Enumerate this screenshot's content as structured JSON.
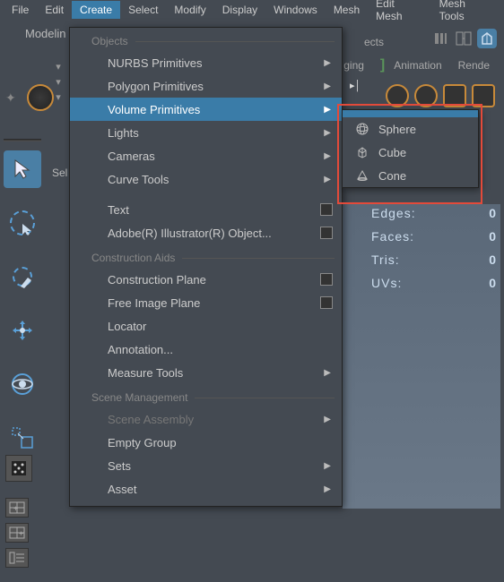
{
  "menubar": [
    "File",
    "Edit",
    "Create",
    "Select",
    "Modify",
    "Display",
    "Windows",
    "Mesh",
    "Edit Mesh",
    "Mesh Tools"
  ],
  "active_menu_index": 2,
  "mode_label": "Modelin",
  "ects_fragment": "ects",
  "shelf_tabs": {
    "ging": "ging",
    "animation": "Animation",
    "render": "Rende"
  },
  "sel_label": "Sel",
  "hud": [
    {
      "label": "Edges:",
      "value": "0"
    },
    {
      "label": "Faces:",
      "value": "0"
    },
    {
      "label": "Tris:",
      "value": "0"
    },
    {
      "label": "UVs:",
      "value": "0"
    }
  ],
  "dropdown": {
    "sections": {
      "objects": "Objects",
      "construction": "Construction Aids",
      "scene": "Scene Management"
    },
    "items": {
      "nurbs": "NURBS Primitives",
      "polygon": "Polygon Primitives",
      "volume": "Volume Primitives",
      "lights": "Lights",
      "cameras": "Cameras",
      "curve": "Curve Tools",
      "text": "Text",
      "illustrator": "Adobe(R) Illustrator(R) Object...",
      "cplane": "Construction Plane",
      "fip": "Free Image Plane",
      "locator": "Locator",
      "annotation": "Annotation...",
      "measure": "Measure Tools",
      "sceneasm": "Scene Assembly",
      "emptygrp": "Empty Group",
      "sets": "Sets",
      "asset": "Asset"
    }
  },
  "submenu": {
    "sphere": "Sphere",
    "cube": "Cube",
    "cone": "Cone"
  }
}
